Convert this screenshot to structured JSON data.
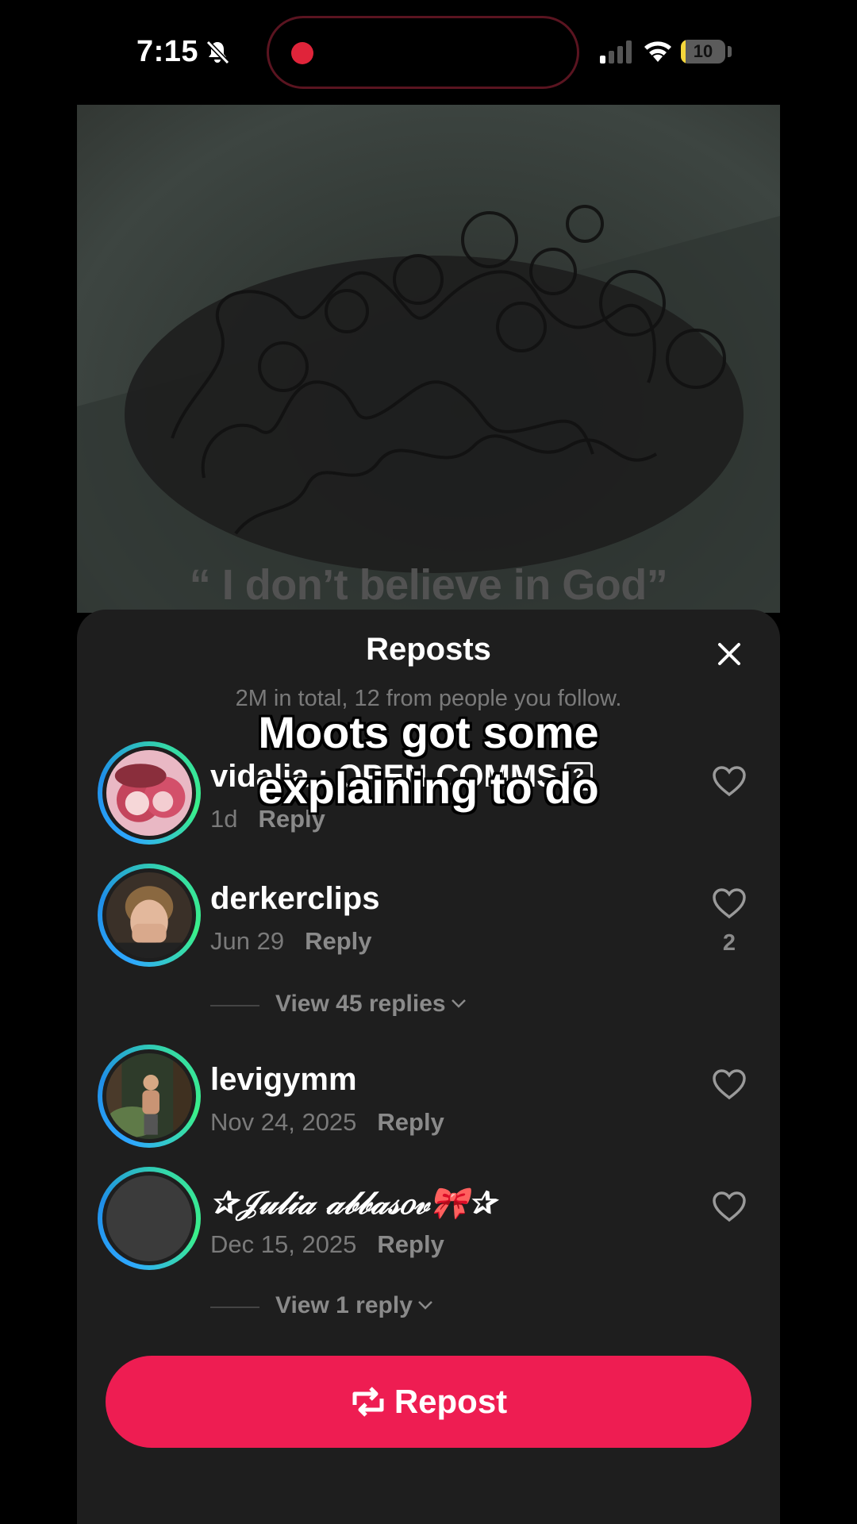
{
  "status_bar": {
    "time": "7:15",
    "battery_level": "10",
    "battery_fraction": 0.1,
    "icons": [
      "bell-slash-icon",
      "signal-icon",
      "wifi-icon",
      "battery-icon"
    ],
    "recording_color": "#e0243a"
  },
  "video": {
    "caption": "“ I don’t believe in God”"
  },
  "overlay": {
    "line1": "Moots got some",
    "line2": "explaining to do"
  },
  "sheet": {
    "title": "Reposts",
    "subtitle": "2M in total, 12 from people you follow.",
    "reply_label": "Reply"
  },
  "reposts": [
    {
      "username": "vidalia : OPEN COMMS",
      "tag": "?",
      "time": "1d",
      "reply": "Reply",
      "likes": "",
      "avatar": "anime-art"
    },
    {
      "username": "derkerclips",
      "time": "Jun 29",
      "reply": "Reply",
      "likes": "2",
      "avatar": "person-face"
    },
    {
      "username": "levigymm",
      "time": "Nov 24, 2025",
      "reply": "Reply",
      "likes": "",
      "avatar": "forest-photo"
    },
    {
      "username": "✰𝒥𝓊𝓁𝒾𝒶 𝒶𝒷𝒷𝒶𝓈𝑜𝓋🎀✰",
      "time": "Dec 15, 2025",
      "reply": "Reply",
      "likes": "",
      "avatar": "blank"
    }
  ],
  "view_replies": [
    {
      "label": "View 45 replies"
    },
    {
      "label": "View 1 reply"
    }
  ],
  "repost_button": {
    "label": "Repost",
    "color": "#ee1d52"
  }
}
